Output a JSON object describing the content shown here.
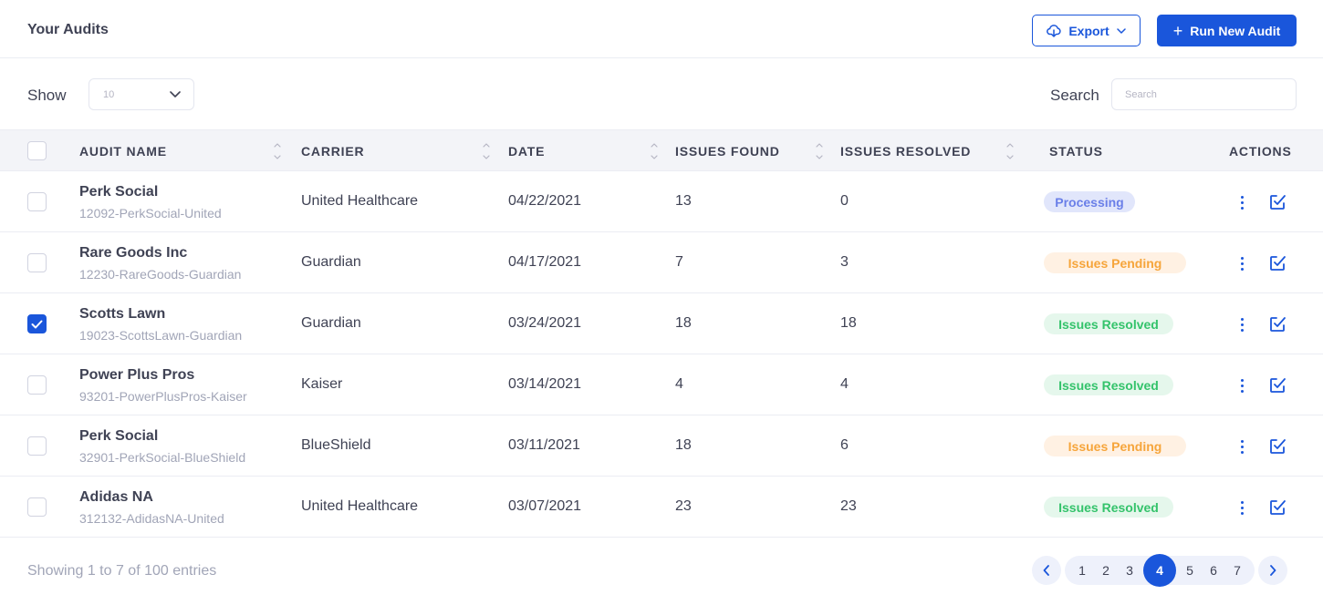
{
  "header": {
    "title": "Your Audits",
    "export_label": "Export",
    "run_label": "Run New Audit"
  },
  "controls": {
    "show_label": "Show",
    "show_value": "10",
    "search_label": "Search",
    "search_placeholder": "Search"
  },
  "table": {
    "columns": [
      "AUDIT NAME",
      "CARRIER",
      "DATE",
      "ISSUES FOUND",
      "ISSUES RESOLVED",
      "STATUS",
      "ACTIONS"
    ],
    "rows": [
      {
        "name": "Perk Social",
        "code": "12092-PerkSocial-United",
        "carrier": "United Healthcare",
        "date": "04/22/2021",
        "found": "13",
        "resolved": "0",
        "status": "Processing",
        "checked": false
      },
      {
        "name": "Rare Goods Inc",
        "code": "12230-RareGoods-Guardian",
        "carrier": "Guardian",
        "date": "04/17/2021",
        "found": "7",
        "resolved": "3",
        "status": "Issues Pending",
        "checked": false
      },
      {
        "name": "Scotts Lawn",
        "code": "19023-ScottsLawn-Guardian",
        "carrier": "Guardian",
        "date": "03/24/2021",
        "found": "18",
        "resolved": "18",
        "status": "Issues Resolved",
        "checked": true
      },
      {
        "name": "Power Plus Pros",
        "code": "93201-PowerPlusPros-Kaiser",
        "carrier": "Kaiser",
        "date": "03/14/2021",
        "found": "4",
        "resolved": "4",
        "status": "Issues Resolved",
        "checked": false
      },
      {
        "name": "Perk Social",
        "code": "32901-PerkSocial-BlueShield",
        "carrier": "BlueShield",
        "date": "03/11/2021",
        "found": "18",
        "resolved": "6",
        "status": "Issues Pending",
        "checked": false
      },
      {
        "name": "Adidas NA",
        "code": "312132-AdidasNA-United",
        "carrier": "United Healthcare",
        "date": "03/07/2021",
        "found": "23",
        "resolved": "23",
        "status": "Issues Resolved",
        "checked": false
      }
    ]
  },
  "footer": {
    "summary": "Showing 1 to 7 of 100 entries",
    "pages": [
      "1",
      "2",
      "3",
      "4",
      "5",
      "6",
      "7"
    ],
    "current_page": "4"
  },
  "colors": {
    "accent": "#1a56db",
    "processing": "#6a7fe8",
    "pending": "#f6a53b",
    "resolved": "#34c36b"
  },
  "icons": {
    "export": "cloud-download-icon",
    "export_caret": "chevron-down-icon",
    "run": "plus-icon",
    "select_caret": "chevron-down-icon",
    "sort": "sort-icon",
    "row_menu": "more-vertical-icon",
    "row_edit": "edit-check-icon",
    "prev": "chevron-left-icon",
    "next": "chevron-right-icon"
  }
}
